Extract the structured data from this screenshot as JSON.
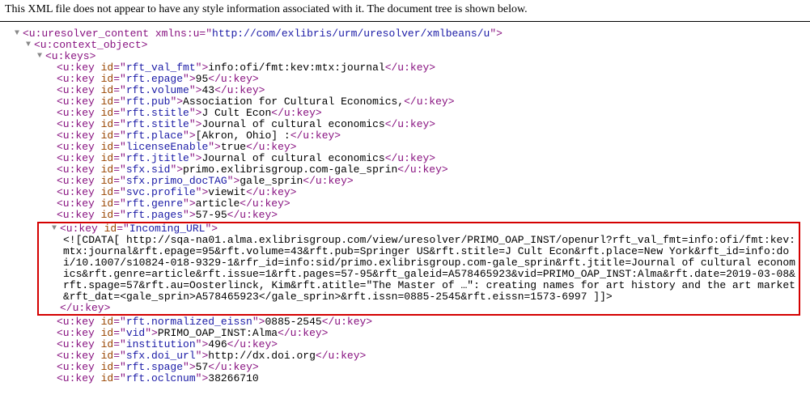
{
  "banner": "This XML file does not appear to have any style information associated with it. The document tree is shown below.",
  "root": {
    "open": "<u:uresolver_content xmlns:u=\"",
    "ns": "http://com/exlibris/urm/uresolver/xmlbeans/u",
    "open_end": "\">",
    "ctx_open": "<u:context_object>",
    "keys_open": "<u:keys>"
  },
  "keys": [
    {
      "id": "rft_val_fmt",
      "val": "info:ofi/fmt:kev:mtx:journal"
    },
    {
      "id": "rft.epage",
      "val": "95"
    },
    {
      "id": "rft.volume",
      "val": "43"
    },
    {
      "id": "rft.pub",
      "val": "Association for Cultural Economics,"
    },
    {
      "id": "rft.stitle",
      "val": "J Cult Econ"
    },
    {
      "id": "rft.stitle",
      "val": "Journal of cultural economics"
    },
    {
      "id": "rft.place",
      "val": "[Akron, Ohio] :"
    },
    {
      "id": "licenseEnable",
      "val": "true"
    },
    {
      "id": "rft.jtitle",
      "val": "Journal of cultural economics"
    },
    {
      "id": "sfx.sid",
      "val": "primo.exlibrisgroup.com-gale_sprin"
    },
    {
      "id": "sfx.primo_docTAG",
      "val": "gale_sprin"
    },
    {
      "id": "svc.profile",
      "val": "viewit"
    },
    {
      "id": "rft.genre",
      "val": "article"
    },
    {
      "id": "rft.pages",
      "val": "57-95"
    }
  ],
  "incoming": {
    "id": "Incoming_URL",
    "cdata": "<![CDATA[ http://sqa-na01.alma.exlibrisgroup.com/view/uresolver/PRIMO_OAP_INST/openurl?rft_val_fmt=info:ofi/fmt:kev:mtx:journal&rft.epage=95&rft.volume=43&rft.pub=Springer US&rft.stitle=J Cult Econ&rft.place=New York&rft_id=info:doi/10.1007/s10824-018-9329-1&rfr_id=info:sid/primo.exlibrisgroup.com-gale_sprin&rft.jtitle=Journal of cultural economics&rft.genre=article&rft.issue=1&rft.pages=57-95&rft_galeid=A578465923&vid=PRIMO_OAP_INST:Alma&rft.date=2019-03-08&rft.spage=57&rft.au=Oosterlinck, Kim&rft.atitle=\"The Master of …\": creating names for art history and the art market&rft_dat=<gale_sprin>A578465923</gale_sprin>&rft.issn=0885-2545&rft.eissn=1573-6997 ]]>",
    "close": "</u:key>"
  },
  "keys2": [
    {
      "id": "rft.normalized_eissn",
      "val": "0885-2545"
    },
    {
      "id": "vid",
      "val": "PRIMO_OAP_INST:Alma"
    },
    {
      "id": "institution",
      "val": "496"
    },
    {
      "id": "sfx.doi_url",
      "val": "http://dx.doi.org"
    },
    {
      "id": "rft.spage",
      "val": "57"
    },
    {
      "id": "rft.oclcnum",
      "val": "38266710"
    }
  ],
  "labels": {
    "ukey_open_a": "<u:key ",
    "id_attr": "id",
    "eq": "=\"",
    "q_close_gt": "\">",
    "ukey_close": "</u:key>"
  }
}
